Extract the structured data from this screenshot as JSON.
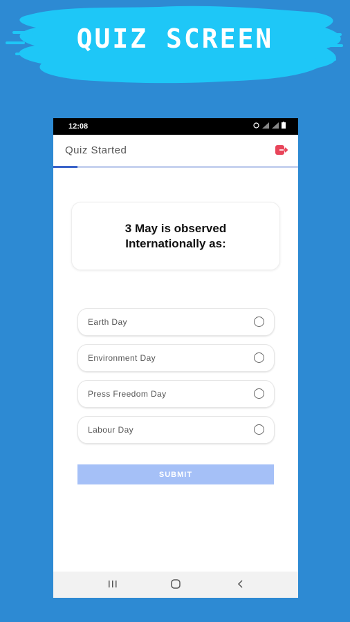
{
  "banner": {
    "title": "QUIZ SCREEN"
  },
  "status_bar": {
    "time": "12:08"
  },
  "app_bar": {
    "title": "Quiz Started"
  },
  "progress": {
    "fraction": 0.1
  },
  "question": {
    "text": "3 May is observed Internationally as:"
  },
  "options": [
    {
      "label": "Earth Day",
      "selected": false
    },
    {
      "label": "Environment Day",
      "selected": false
    },
    {
      "label": "Press Freedom Day",
      "selected": false
    },
    {
      "label": "Labour Day",
      "selected": false
    }
  ],
  "submit": {
    "label": "SUBMIT"
  },
  "colors": {
    "background": "#2d8ad3",
    "banner_blob": "#1ec7f7",
    "exit_icon": "#e8455a",
    "progress_fill": "#3a63c9",
    "submit_button": "#a5c0f7"
  },
  "icons": {
    "exit": "exit-icon",
    "nav_recent": "recent-apps-icon",
    "nav_home": "home-icon",
    "nav_back": "back-icon"
  }
}
